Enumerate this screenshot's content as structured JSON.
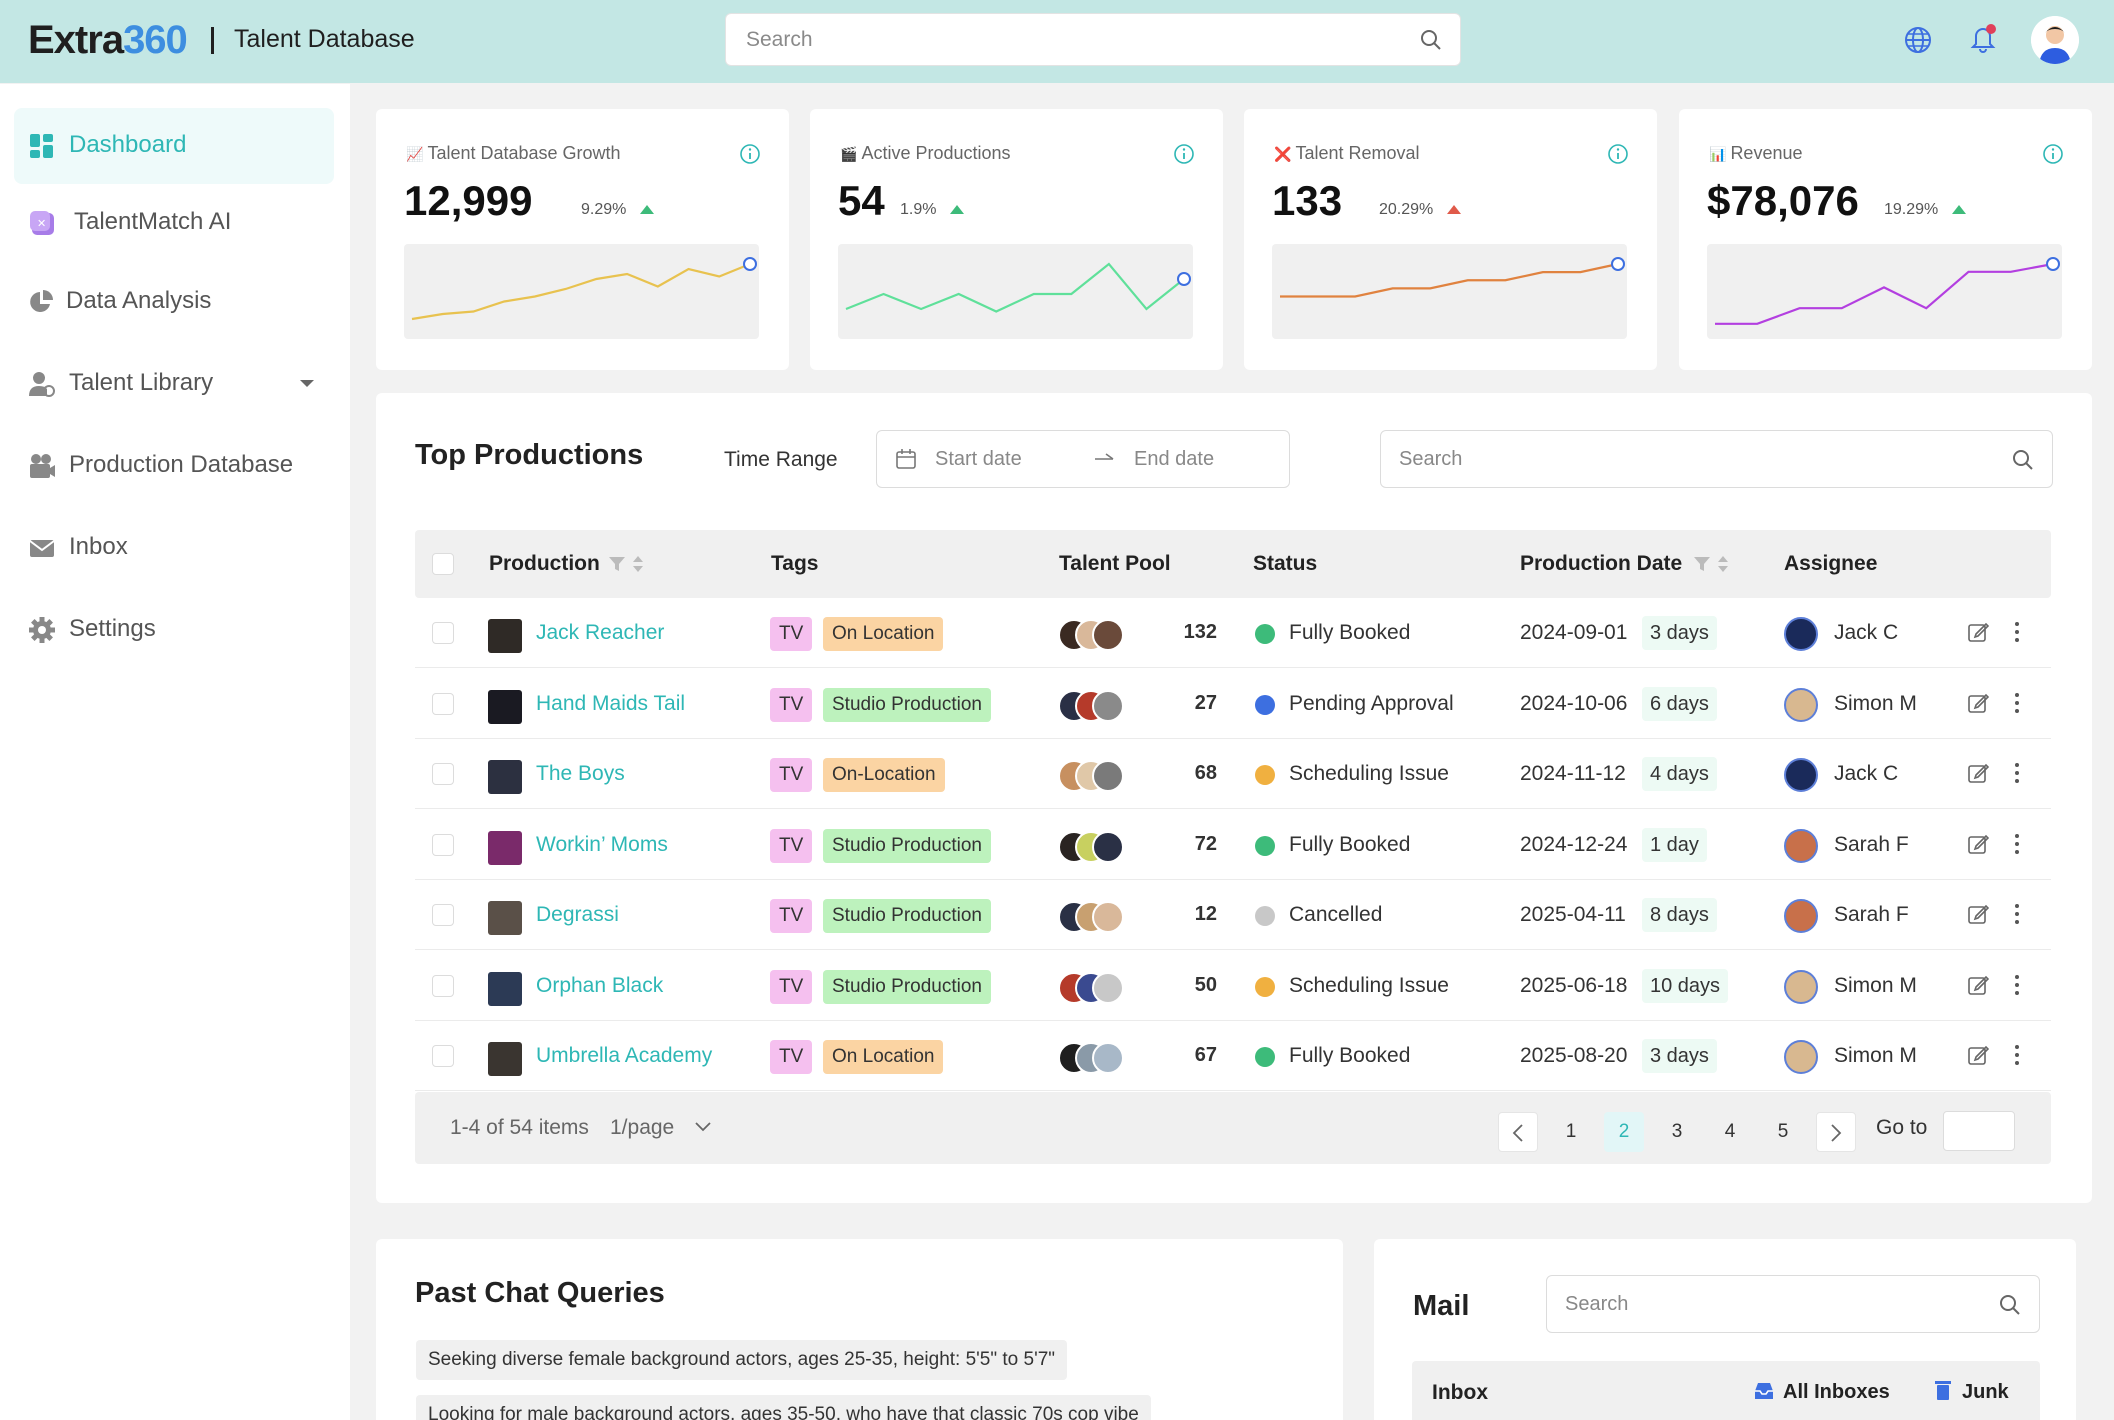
{
  "header": {
    "logo_main": "Extra",
    "logo_accent": "360",
    "subtitle": "Talent Database",
    "search_placeholder": "Search"
  },
  "sidebar": {
    "items": [
      {
        "label": "Dashboard",
        "icon": "dashboard-icon",
        "active": true
      },
      {
        "label": "TalentMatch AI",
        "icon": "ai-icon"
      },
      {
        "label": "Data Analysis",
        "icon": "pie-chart-icon"
      },
      {
        "label": "Talent Library",
        "icon": "user-icon"
      },
      {
        "label": "Production Database",
        "icon": "camera-icon"
      },
      {
        "label": "Inbox",
        "icon": "mail-icon"
      },
      {
        "label": "Settings",
        "icon": "gear-icon"
      }
    ]
  },
  "kpis": [
    {
      "title": "Talent Database Growth",
      "value": "12,999",
      "change": "9.29%",
      "trend": "up",
      "color": "#e8c24f",
      "icon": "📈",
      "spark": [
        2,
        3,
        3.5,
        5.5,
        6.5,
        8,
        10,
        11,
        8.5,
        12,
        10.5,
        13
      ]
    },
    {
      "title": "Active Productions",
      "value": "54",
      "change": "1.9%",
      "trend": "up",
      "color": "#5fe09a",
      "icon": "🎬",
      "spark": [
        4,
        7,
        4,
        7,
        3.5,
        7,
        7,
        13,
        4,
        10
      ]
    },
    {
      "title": "Talent Removal",
      "value": "133",
      "change": "20.29%",
      "trend": "down",
      "color": "#e0823f",
      "icon": "❌",
      "spark": [
        2,
        2,
        2,
        2.5,
        2.5,
        3,
        3,
        3.5,
        3.5,
        4
      ]
    },
    {
      "title": "Revenue",
      "value": "$78,076",
      "change": "19.29%",
      "trend": "up",
      "color": "#b33fe0",
      "icon": "📊",
      "spark": [
        1,
        1,
        4,
        4,
        8,
        4,
        11,
        11,
        12.5
      ]
    }
  ],
  "top": {
    "title": "Top Productions",
    "time_range": "Time Range",
    "start": "Start date",
    "end": "End date",
    "search": "Search",
    "cols": {
      "production": "Production",
      "tags": "Tags",
      "pool": "Talent Pool",
      "status": "Status",
      "date": "Production Date",
      "assignee": "Assignee"
    },
    "rows": [
      {
        "name": "Jack Reacher",
        "tag1": "TV",
        "tag2": "On Location",
        "tag2type": "loc",
        "pool": "132",
        "status": "Fully Booked",
        "stype": "ok",
        "date": "2024-09-01",
        "days": "3 days",
        "assignee": "Jack C",
        "thumb": "#2f2a26"
      },
      {
        "name": "Hand Maids Tail",
        "tag1": "TV",
        "tag2": "Studio Production",
        "tag2type": "stu",
        "pool": "27",
        "status": "Pending Approval",
        "stype": "pend",
        "date": "2024-10-06",
        "days": "6 days",
        "assignee": "Simon M",
        "thumb": "#1a1a22"
      },
      {
        "name": "The Boys",
        "tag1": "TV",
        "tag2": "On-Location",
        "tag2type": "loc",
        "pool": "68",
        "status": "Scheduling Issue",
        "stype": "warn",
        "date": "2024-11-12",
        "days": "4 days",
        "assignee": "Jack C",
        "thumb": "#2c3040"
      },
      {
        "name": "Workin’ Moms",
        "tag1": "TV",
        "tag2": "Studio Production",
        "tag2type": "stu",
        "pool": "72",
        "status": "Fully Booked",
        "stype": "ok",
        "date": "2024-12-24",
        "days": "1 day",
        "assignee": "Sarah F",
        "thumb": "#7a2a6a"
      },
      {
        "name": "Degrassi",
        "tag1": "TV",
        "tag2": "Studio Production",
        "tag2type": "stu",
        "pool": "12",
        "status": "Cancelled",
        "stype": "cancel",
        "date": "2025-04-11",
        "days": "8 days",
        "assignee": "Sarah F",
        "thumb": "#5a5048"
      },
      {
        "name": "Orphan Black",
        "tag1": "TV",
        "tag2": "Studio Production",
        "tag2type": "stu",
        "pool": "50",
        "status": "Scheduling Issue",
        "stype": "warn",
        "date": "2025-06-18",
        "days": "10 days",
        "assignee": "Simon M",
        "thumb": "#2c3a55"
      },
      {
        "name": "Umbrella Academy",
        "tag1": "TV",
        "tag2": "On Location",
        "tag2type": "loc",
        "pool": "67",
        "status": "Fully Booked",
        "stype": "ok",
        "date": "2025-08-20",
        "days": "3 days",
        "assignee": "Simon M",
        "thumb": "#3a3530"
      }
    ],
    "pager": {
      "info": "1-4 of 54 items",
      "per": "1/page",
      "pages": [
        "1",
        "2",
        "3",
        "4",
        "5"
      ],
      "active": "2",
      "goto": "Go to"
    }
  },
  "chat": {
    "title": "Past Chat Queries",
    "queries": [
      "Seeking diverse female background actors, ages 25-35, height: 5'5\" to 5'7\"",
      "Looking for male background actors, ages 35-50, who have that classic 70s cop vibe"
    ]
  },
  "mail": {
    "title": "Mail",
    "search": "Search",
    "inbox": "Inbox",
    "all": "All Inboxes",
    "junk": "Junk"
  }
}
